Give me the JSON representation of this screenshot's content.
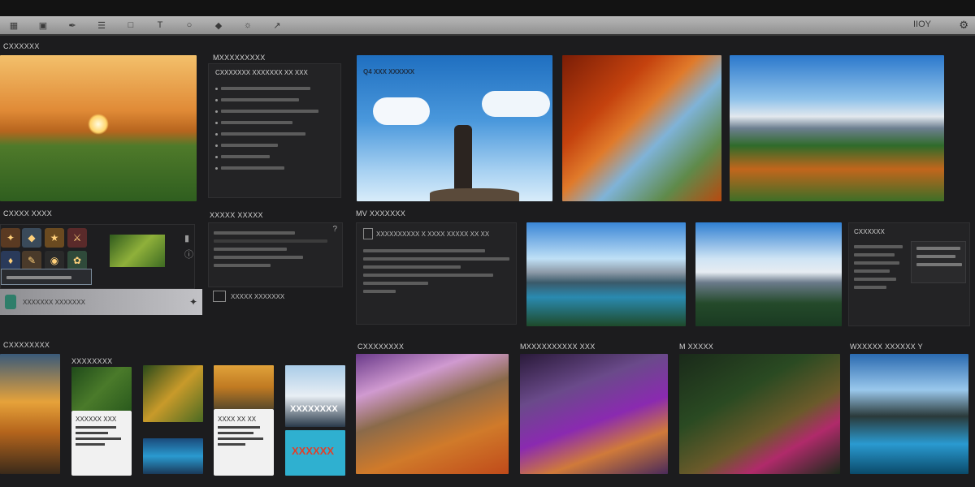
{
  "app": {
    "title": "IIOY"
  },
  "toolbar": {
    "icons": [
      "grid-icon",
      "image-icon",
      "brush-icon",
      "layers-icon",
      "crop-icon",
      "text-icon",
      "shape-icon",
      "filter-icon",
      "adjust-icon",
      "export-icon"
    ]
  },
  "sections": {
    "left_top": "CXXXXXX",
    "middle_top_panel": "MXXXXXXXXX",
    "gallery_top_caption": "Q4 XXX XXXXXX",
    "left_mid": "CXXXX XXXX",
    "middle_mid_panel": "XXXXX XXXXX",
    "gallery_mid": "MV XXXXXXX",
    "bottom_left": "CXXXXXXXX",
    "bottom_mid": "XXXXXXXX",
    "bottom_gallery1": "CXXXXXXXX",
    "bottom_gallery2": "MXXXXXXXXXX XXX",
    "bottom_gallery3": "M XXXXX",
    "bottom_gallery4": "WXXXXX XXXXXX Y"
  },
  "panel_text": {
    "middle_heading": "CXXXXXXX XXXXXXX XX XXX",
    "search_bar": "XXXXXXX XXXXXXX",
    "left_action": "XXXXX XXXXXXX",
    "gallery_mid_heading": "XXXXXXXXXX X XXXX XXXXX XX XX",
    "card1_title": "XXXXXX XXX",
    "card2_title": "XXXX XX XX",
    "card3_title": "XXXXXXXX",
    "card4_title": "XXXXXX"
  },
  "colors": {
    "background": "#1c1c1e",
    "accent": "#3b82c4"
  }
}
